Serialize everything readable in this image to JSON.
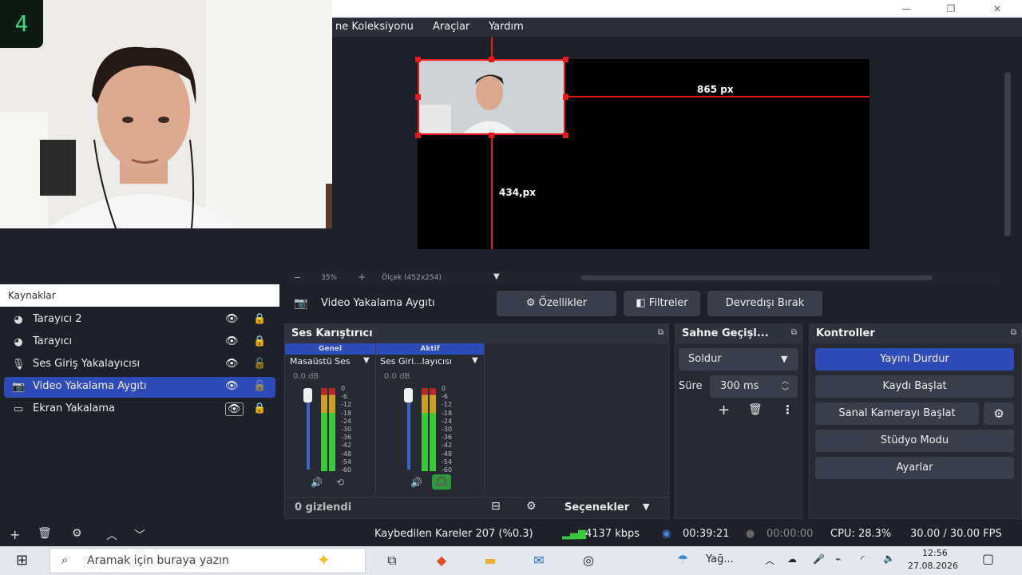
{
  "menu": {
    "scene_collection": "ne Koleksiyonu",
    "tools": "Araçlar",
    "help": "Yardım"
  },
  "window_controls": {
    "minimize": "—",
    "maximize": "❐",
    "close": "✕"
  },
  "preview": {
    "width_label": "865 px",
    "height_label": "434,px",
    "zoom": "35%",
    "scale": "Ölçek (452x254)",
    "zoom_minus": "−",
    "zoom_plus": "+",
    "badge": "4"
  },
  "webcam_badge": "4",
  "sources": {
    "header": "Kaynaklar",
    "items": [
      {
        "label": "Tarayıcı 2",
        "icon": "globe-icon",
        "locked": true
      },
      {
        "label": "Tarayıcı",
        "icon": "globe-icon",
        "locked": true
      },
      {
        "label": "Ses Giriş Yakalayıcısı",
        "icon": "microphone-icon",
        "locked": false
      },
      {
        "label": "Video Yakalama Aygıtı",
        "icon": "camera-icon",
        "locked": false,
        "selected": true
      },
      {
        "label": "Ekran Yakalama",
        "icon": "monitor-icon",
        "locked": true
      }
    ]
  },
  "source_bar": {
    "selected_source": "Video Yakalama Aygıtı",
    "properties": "Özellikler",
    "filters": "Filtreler",
    "deactivate": "Devredışı Bırak"
  },
  "mixer": {
    "title": "Ses Karıştırıcı",
    "channels": [
      {
        "tab": "Genel",
        "name": "Masaüstü Ses",
        "db": "0.0 dB"
      },
      {
        "tab": "Aktif",
        "name": "Ses Giri...layıcısı",
        "db": "0.0 dB"
      }
    ],
    "scale": [
      "0",
      "-6",
      "-12",
      "-18",
      "-24",
      "-30",
      "-36",
      "-42",
      "-48",
      "-54",
      "-60"
    ],
    "hidden": "0 gizlendi",
    "options": "Seçenekler"
  },
  "transitions": {
    "title": "Sahne Geçişl...",
    "type": "Soldur",
    "duration_label": "Süre",
    "duration_value": "300 ms"
  },
  "controls": {
    "title": "Kontroller",
    "stop_stream": "Yayını Durdur",
    "start_record": "Kaydı Başlat",
    "start_virtualcam": "Sanal Kamerayı Başlat",
    "studio_mode": "Stüdyo Modu",
    "settings": "Ayarlar"
  },
  "status": {
    "dropped_frames": "Kaybedilen Kareler 207 (%0.3)",
    "bitrate": "4137 kbps",
    "stream_time": "00:39:21",
    "record_time": "00:00:00",
    "cpu": "CPU: 28.3%",
    "fps": "30.00 / 30.00 FPS"
  },
  "taskbar": {
    "search_placeholder": "Aramak için buraya yazın",
    "weather": "Yağ...",
    "time": "12:56",
    "date": "27.08.2026"
  },
  "colors": {
    "accent": "#2e4cb8",
    "guide_red": "#e31b1b",
    "panel": "#272a33",
    "background": "#1e2129"
  }
}
